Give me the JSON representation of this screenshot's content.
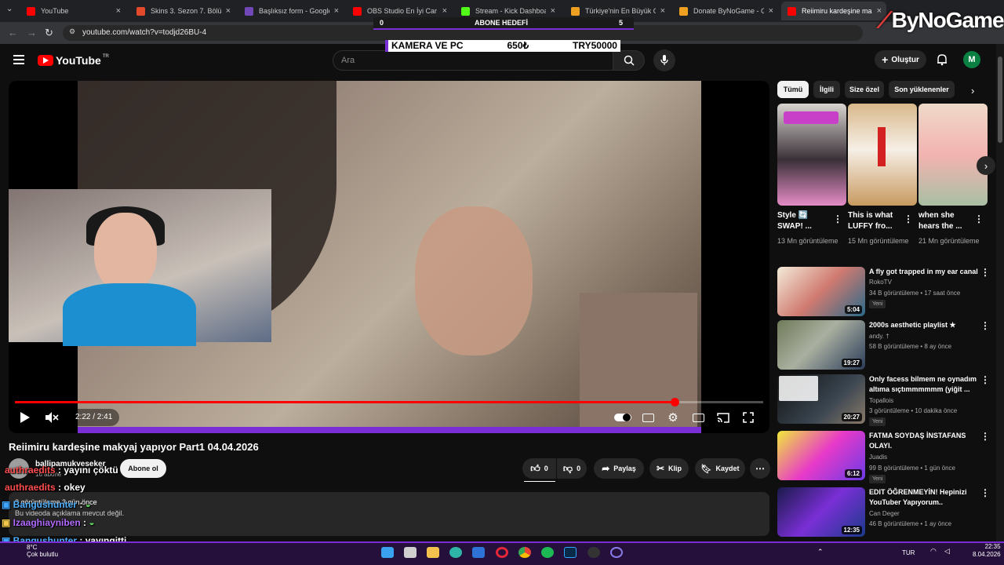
{
  "browser": {
    "tabs": [
      {
        "label": "YouTube",
        "fav_color": "#ff0000"
      },
      {
        "label": "Skins 3. Sezon 7. Bölüm",
        "fav_color": "#e24a2b"
      },
      {
        "label": "Başlıksız form - Google F",
        "fav_color": "#7248b9"
      },
      {
        "label": "OBS Studio En İyi Car",
        "fav_color": "#ff0000"
      },
      {
        "label": "Stream - Kick Dashboard",
        "fav_color": "#53fc18"
      },
      {
        "label": "Türkiye'nin En Büyük Oyu",
        "fav_color": "#f0a020"
      },
      {
        "label": "Donate ByNoGame - Gele",
        "fav_color": "#f0a020"
      },
      {
        "label": "Reiimiru kardeşine makya",
        "fav_color": "#ff0000"
      }
    ],
    "url": "youtube.com/watch?v=todjd26BU-4"
  },
  "overlay": {
    "sub_goal": {
      "left": "0",
      "label": "ABONE HEDEFİ",
      "right": "5"
    },
    "donate": {
      "left": "KAMERA VE PC",
      "mid": "650₺",
      "right": "TRY50000"
    },
    "brand": "ByNoGame"
  },
  "youtube": {
    "logo": "YouTube",
    "logo_region": "TR",
    "search_placeholder": "Ara",
    "create_label": "Oluştur",
    "avatar_letter": "M"
  },
  "player": {
    "time": "2:22 / 2:41",
    "progress_fraction": 0.882
  },
  "video": {
    "title": "Reiimiru kardeşine makyaj yapıyor Part1 04.04.2026",
    "channel": "ballipamukveseker",
    "subs": "16 abone",
    "subscribe_label": "Abone ol",
    "likes": "0",
    "dislikes": "0",
    "share_label": "Paylaş",
    "clip_label": "Klip",
    "save_label": "Kaydet",
    "desc_stats": "8 görüntüleme  3 gün önce",
    "desc_text": "Bu videoda açıklama mevcut değil."
  },
  "chat": [
    {
      "user": "authraedits",
      "sep": " : ",
      "msg": "yayını çöktü"
    },
    {
      "user": "authraedits",
      "sep": " : ",
      "msg": "okey"
    },
    {
      "user": "Bangushunter",
      "sep": " : ",
      "msg": ""
    },
    {
      "user": "Izaaghiayniben",
      "sep": " : ",
      "msg": ""
    },
    {
      "user": "Bangushunter",
      "sep": " : ",
      "msg": "yayıngitti"
    }
  ],
  "sidebar": {
    "chips": [
      "Tümü",
      "İlgili",
      "Size özel",
      "Son yüklenenler"
    ],
    "shorts": [
      {
        "title": "Style 🔄 SWAP! ...",
        "views": "13 Mn görüntüleme"
      },
      {
        "title": "This is what LUFFY fro...",
        "views": "15 Mn görüntüleme"
      },
      {
        "title": "when she hears the ...",
        "views": "21 Mn görüntüleme"
      }
    ],
    "videos": [
      {
        "title": "A fly got trapped in my ear canal",
        "channel": "RokoTV",
        "meta": "34 B görüntüleme • 17 saat önce",
        "badge": "Yeni",
        "duration": "5:04"
      },
      {
        "title": "2000s aesthetic playlist ★",
        "channel": "andy. †",
        "meta": "58 B görüntüleme • 8 ay önce",
        "badge": "",
        "duration": "19:27"
      },
      {
        "title": "Only facess bilmem ne oynadım altıma sıçtımmmmmm (yiğit ...",
        "channel": "Topallois",
        "meta": "3 görüntüleme • 10 dakika önce",
        "badge": "Yeni",
        "duration": "20:27"
      },
      {
        "title": "FATMA SOYDAŞ İNSTAFANS OLAYI.",
        "channel": "Juadis",
        "meta": "99 B görüntüleme • 1 gün önce",
        "badge": "Yeni",
        "duration": "6:12"
      },
      {
        "title": "EDIT ÖĞRENMEYİN! Hepinizi YouTuber Yapıyorum..",
        "channel": "Can Deger",
        "meta": "46 B görüntüleme • 1 ay önce",
        "badge": "",
        "duration": "12:35"
      }
    ]
  },
  "taskbar": {
    "weather_temp": "8°C",
    "weather_desc": "Çok bulutlu",
    "lang": "TUR",
    "time": "22:35",
    "date": "8.04.2026"
  },
  "colors": {
    "accent": "#ff0000",
    "stream_purple": "#7a2fd6"
  }
}
